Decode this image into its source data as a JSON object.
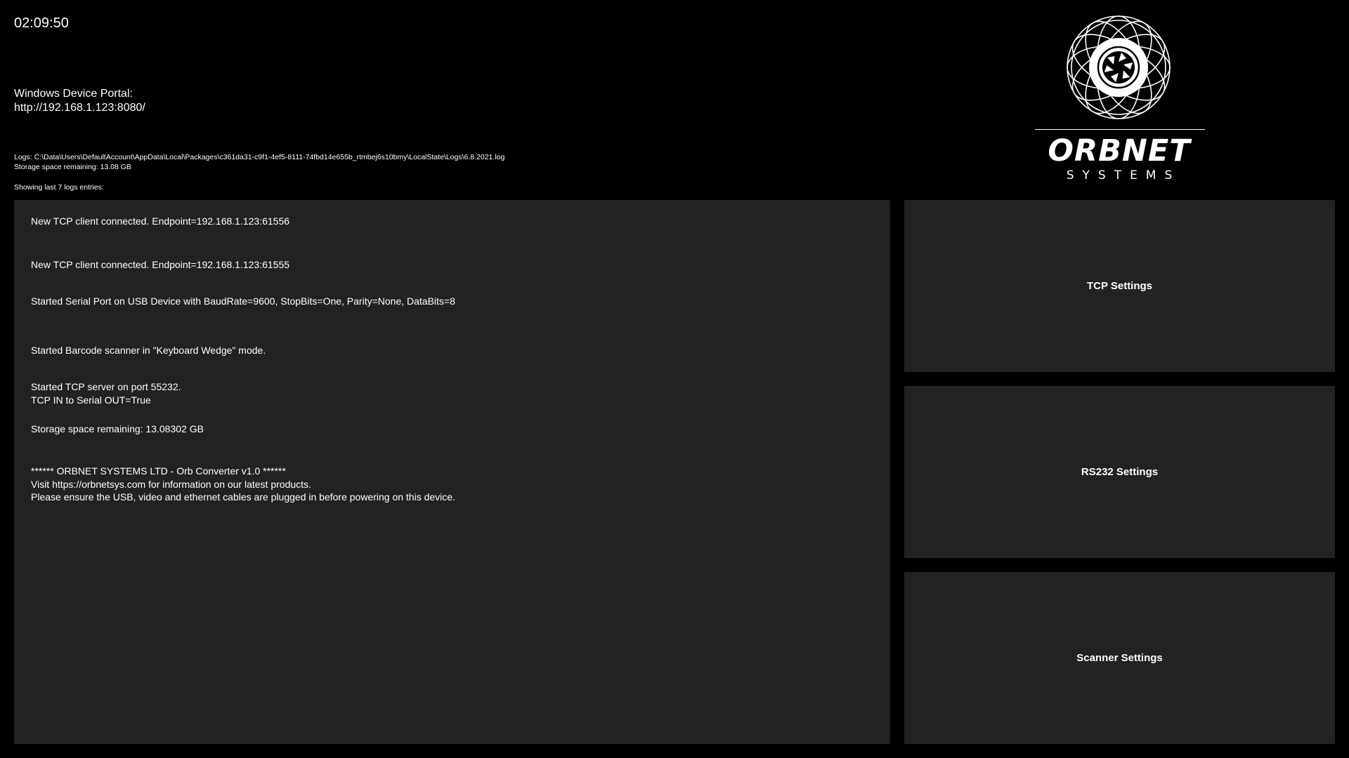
{
  "clock": "02:09:50",
  "portal": {
    "label": "Windows Device Portal:",
    "url": "http://192.168.1.123:8080/"
  },
  "logs_path": "Logs: C:\\Data\\Users\\DefaultAccount\\AppData\\Local\\Packages\\c361da31-c9f1-4ef5-8111-74fbd14e655b_rtmbej6s10bmy\\LocalState\\Logs\\6.8.2021.log",
  "storage": "Storage space remaining: 13.08 GB",
  "showing": "Showing last 7 logs entries:",
  "log_entries": [
    "New TCP client connected. Endpoint=192.168.1.123:61556",
    "New TCP client connected. Endpoint=192.168.1.123:61555",
    "Started Serial Port on USB Device  with BaudRate=9600, StopBits=One, Parity=None, DataBits=8",
    "Started Barcode scanner in \"Keyboard Wedge\" mode.",
    "Started TCP server on port 55232.\nTCP IN to Serial OUT=True",
    "Storage space remaining: 13.08302 GB",
    "****** ORBNET SYSTEMS LTD - Orb Converter v1.0 ******\nVisit https://orbnetsys.com for information on our latest products.\nPlease ensure the USB, video and ethernet cables are plugged in before powering on this device."
  ],
  "logo": {
    "name": "ORBNET",
    "sub": "SYSTEMS",
    "icon": "orbnet-emblem-icon"
  },
  "buttons": {
    "tcp": "TCP Settings",
    "rs232": "RS232 Settings",
    "scanner": "Scanner Settings"
  },
  "colors": {
    "background": "#000000",
    "panel": "#222222",
    "text": "#ffffff"
  }
}
